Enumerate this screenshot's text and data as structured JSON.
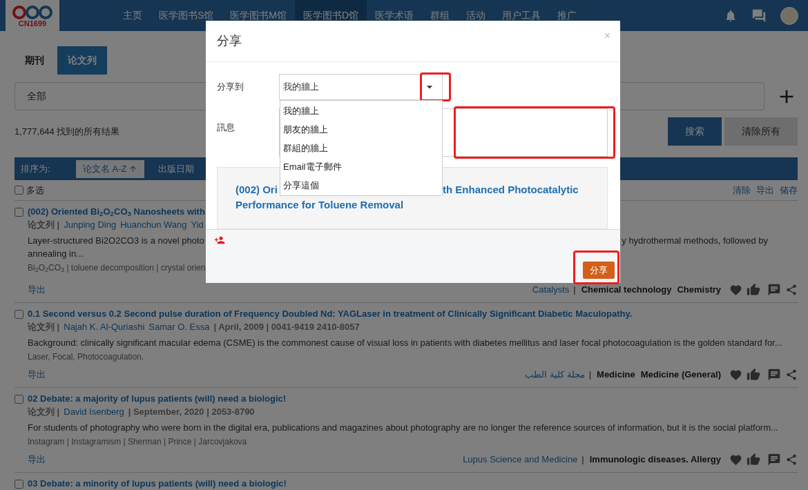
{
  "logo": {
    "text": "CN1699"
  },
  "nav": [
    {
      "label": "主页",
      "selected": false
    },
    {
      "label": "医学图书S馆",
      "selected": false
    },
    {
      "label": "医学图书M馆",
      "selected": false
    },
    {
      "label": "医学图书D馆",
      "selected": true
    },
    {
      "label": "医学术语",
      "selected": false
    },
    {
      "label": "群组",
      "selected": false
    },
    {
      "label": "活动",
      "selected": false
    },
    {
      "label": "用户工具",
      "selected": false
    },
    {
      "label": "推广",
      "selected": false
    }
  ],
  "tabs": [
    {
      "label": "期刊",
      "selected": false
    },
    {
      "label": "论文列",
      "selected": true
    }
  ],
  "search": {
    "value": "全部"
  },
  "results": "1,777,644 找到的所有结果",
  "buttons": {
    "search": "搜索",
    "clear": "清除所有"
  },
  "sort": {
    "label": "排序为:",
    "options": [
      {
        "label": "论文名 A-Z",
        "selected": true
      },
      {
        "label": "出版日期",
        "selected": false
      }
    ]
  },
  "multi_select": {
    "label": "多选",
    "checked": false
  },
  "list_actions": [
    "清除",
    "导出",
    "储存"
  ],
  "rows": [
    {
      "title": "(002) Oriented Bi$_{2}$O$_{2}$CO$_{3}$ Nanosheets with",
      "checked": false,
      "type": "论文列 |",
      "authors": [
        "Junping Ding",
        "Huanchun Wang",
        "Yid"
      ],
      "abstract": [
        [
          "Layer-structured Bi2O2CO3 is a novel photo",
          "y hydrothermal methods, followed by"
        ],
        [
          "annealing in..."
        ]
      ],
      "tags": "Bi$_{2}$O$_{2}$CO$_{3}$ | toluene decomposition | crystal orien",
      "export": "导出",
      "journal": "Catalysts",
      "separator": "|",
      "subjects": [
        "Chemical technology",
        "Chemistry"
      ]
    },
    {
      "title": "0.1 Second versus 0.2 Second pulse duration of Frequency Doubled Nd: YAGLaser in treatment of Clinically Significant Diabetic Maculopathy.",
      "checked": false,
      "type": "论文列 |",
      "authors": [
        "Najah K. Al-Quriashi",
        "Samar O. Essa"
      ],
      "meta": "| April, 2009 | 0041-9419 2410-8057",
      "abstract": [
        [
          "Background: clinically significant macular edema (CSME) is the commonest cause of visual loss in patients with diabetes mellitus and laser focal photocoagulation is the golden standard for..."
        ]
      ],
      "tags": "Laser, Focal, Photocoagulation.",
      "export": "导出",
      "journal": "مجلة كلية الطب",
      "separator": "|",
      "subjects": [
        "Medicine",
        "Medicine (General)"
      ]
    },
    {
      "title": "02 Debate: a majority of lupus patients (will) need a biologic!",
      "checked": false,
      "type": "论文列 |",
      "authors": [
        "David Isenberg"
      ],
      "meta": "| September, 2020 | 2053-8790",
      "abstract": [
        [
          "For students of photography who were born in the digital era, publications and magazines about photography are no longer the reference sources of information, but it is the social platform..."
        ]
      ],
      "tags": "Instagram | Instagramism | Sherman | Prince | Jarcovjakova",
      "export": "导出",
      "journal": "Lupus Science and Medicine",
      "separator": "|",
      "subjects": [
        "Immunologic diseases. Allergy"
      ]
    },
    {
      "title": "03 Debate: a minority of lupus patients (will) need a biologic!",
      "checked": false
    }
  ],
  "dialog": {
    "title": "分享",
    "close": "×",
    "share_to_label": "分享到",
    "share_to_value": "我的牆上",
    "dropdown_open": true,
    "options": [
      {
        "label": "我的牆上",
        "selected": false
      },
      {
        "label": "朋友的牆上",
        "selected": false
      },
      {
        "label": "群組的牆上",
        "selected": false
      },
      {
        "label": "Email電子郵件",
        "selected": false
      },
      {
        "label": "分享這個",
        "selected": false
      }
    ],
    "message_label": "訊息",
    "preview_title": [
      "(002) Ori",
      "th Enhanced Photocatalytic",
      "Performance for Toluene Removal"
    ],
    "submit": "分享"
  }
}
